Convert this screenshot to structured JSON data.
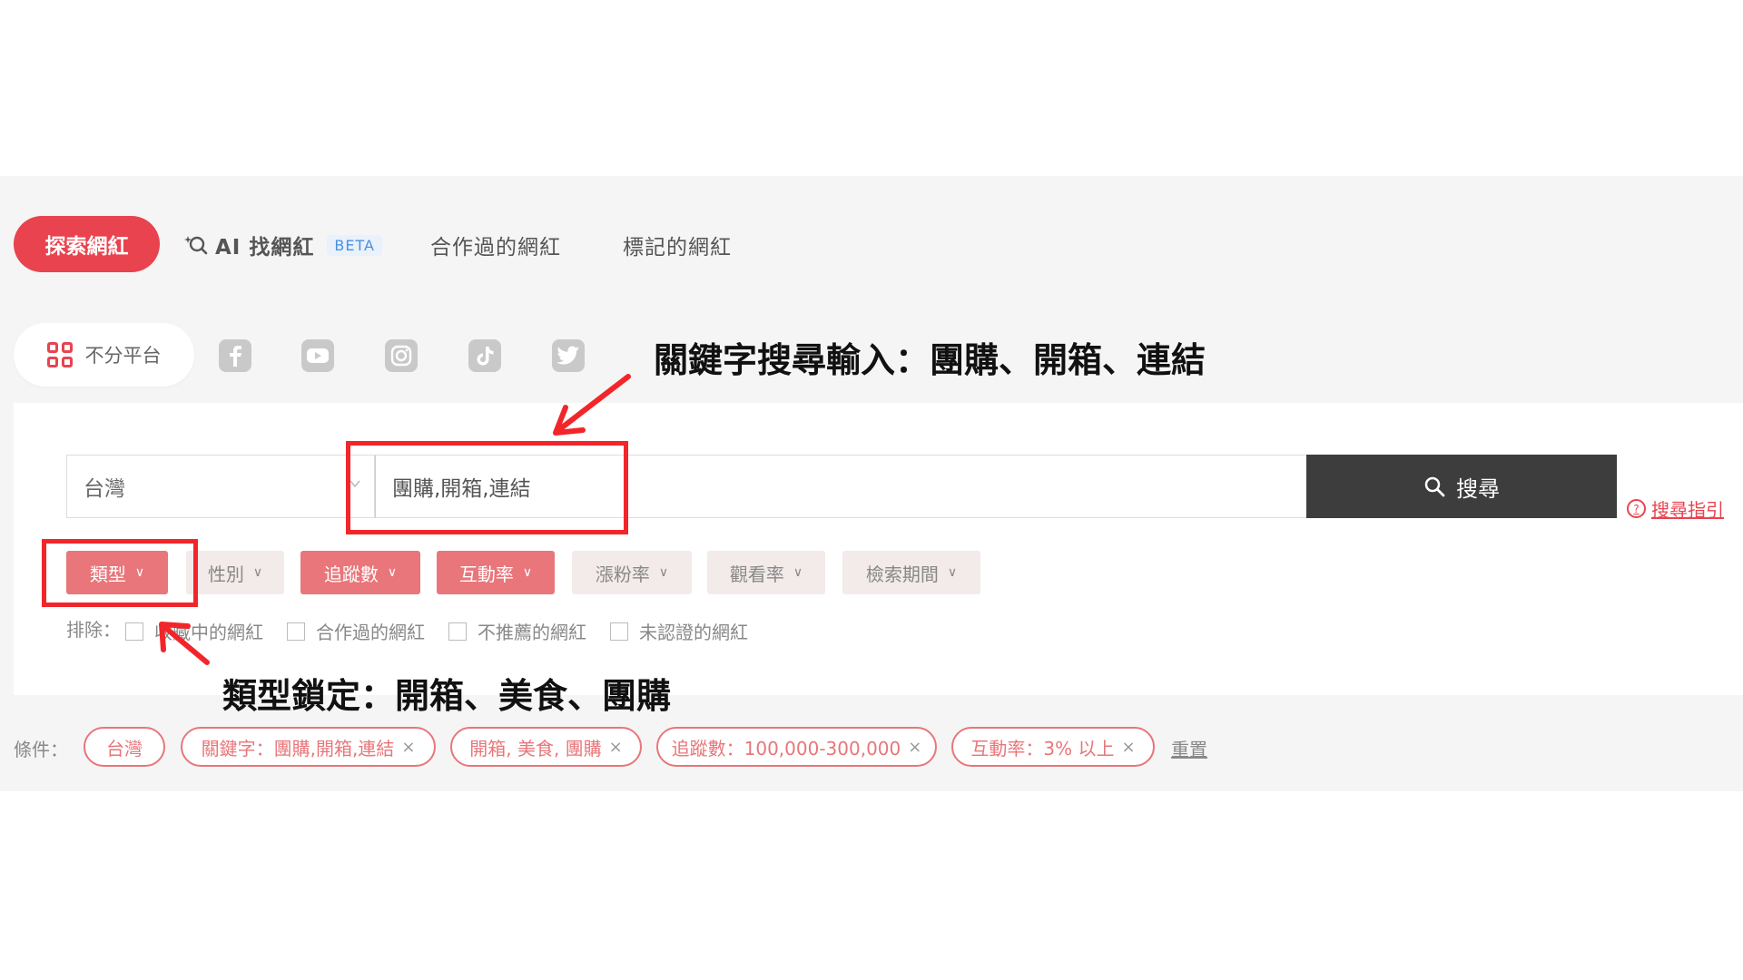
{
  "tabs": {
    "explore": "探索網紅",
    "ai_find": "AI 找網紅",
    "beta": "BETA",
    "cooperated": "合作過的網紅",
    "marked": "標記的網紅"
  },
  "platforms": {
    "all_label": "不分平台",
    "icons": [
      "facebook-icon",
      "youtube-icon",
      "instagram-icon",
      "tiktok-icon",
      "twitter-icon"
    ]
  },
  "search": {
    "country": "台灣",
    "keyword": "團購,開箱,連結",
    "button": "搜尋",
    "guide": "搜尋指引"
  },
  "filters": {
    "type": "類型",
    "gender": "性別",
    "followers": "追蹤數",
    "engagement": "互動率",
    "growth": "漲粉率",
    "view_rate": "觀看率",
    "period": "檢索期間"
  },
  "exclude": {
    "label": "排除：",
    "items": [
      "收藏中的網紅",
      "合作過的網紅",
      "不推薦的網紅",
      "未認證的網紅"
    ]
  },
  "conditions": {
    "label": "條件：",
    "chips": [
      "台灣",
      "關鍵字：團購,開箱,連結",
      "開箱, 美食, 團購",
      "追蹤數：100,000-300,000",
      "互動率：3% 以上"
    ],
    "reset": "重置"
  },
  "annotations": {
    "keyword_note": "關鍵字搜尋輸入：團購、開箱、連結",
    "type_note": "類型鎖定：開箱、美食、團購"
  },
  "colors": {
    "accent": "#e8434f",
    "chip_active": "#e8767a",
    "search_button": "#3d3d3d",
    "annotation_red": "#f2262a"
  }
}
